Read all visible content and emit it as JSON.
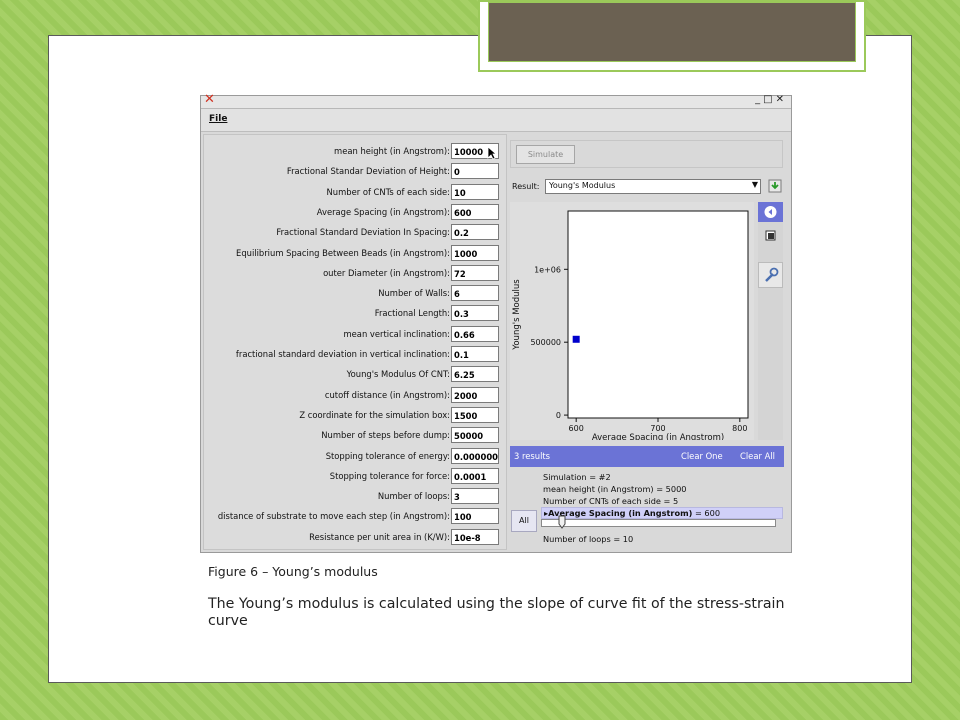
{
  "app": {
    "menu_file": "File",
    "params": [
      {
        "label": "mean height (in Angstrom):",
        "value": "10000"
      },
      {
        "label": "Fractional Standar Deviation of Height:",
        "value": "0"
      },
      {
        "label": "Number of CNTs of each side:",
        "value": "10"
      },
      {
        "label": "Average Spacing (in Angstrom):",
        "value": "600"
      },
      {
        "label": "Fractional Standard Deviation In Spacing:",
        "value": "0.2"
      },
      {
        "label": "Equilibrium Spacing Between Beads (in Angstrom):",
        "value": "1000"
      },
      {
        "label": "outer Diameter (in Angstrom):",
        "value": "72"
      },
      {
        "label": "Number of Walls:",
        "value": "6"
      },
      {
        "label": "Fractional Length:",
        "value": "0.3"
      },
      {
        "label": "mean vertical inclination:",
        "value": "0.66"
      },
      {
        "label": "fractional standard deviation in vertical inclination:",
        "value": "0.1"
      },
      {
        "label": "Young's Modulus Of CNT:",
        "value": "6.25"
      },
      {
        "label": "cutoff distance (in Angstrom):",
        "value": "2000"
      },
      {
        "label": "Z coordinate for the simulation box:",
        "value": "1500"
      },
      {
        "label": "Number of steps before dump:",
        "value": "50000"
      },
      {
        "label": "Stopping tolerance of energy:",
        "value": "0.0000000"
      },
      {
        "label": "Stopping tolerance for force:",
        "value": "0.0001"
      },
      {
        "label": "Number of loops:",
        "value": "3"
      },
      {
        "label": "distance of substrate to move each step (in Angstrom):",
        "value": "100"
      },
      {
        "label": "Resistance per unit area in (K/W):",
        "value": "10e-8"
      }
    ],
    "simulate_label": "Simulate",
    "result_label": "Result:",
    "result_value": "Young's Modulus",
    "results_count": "3 results",
    "clear_one": "Clear One",
    "clear_all": "Clear All",
    "all_label": "All",
    "info": {
      "simulation": "Simulation = #2",
      "mean_height": "mean height (in Angstrom) = 5000",
      "num_cnts": "Number of CNTs of each side = 5",
      "spacing_name": "Average Spacing (in Angstrom)",
      "spacing_value": " = 600",
      "loops": "Number of loops = 10"
    }
  },
  "chart_data": {
    "type": "scatter",
    "xlabel": "Average Spacing (in Angstrom)",
    "ylabel": "Young's Modulus",
    "xlim": [
      590,
      810
    ],
    "ylim": [
      -20000,
      1400000
    ],
    "x_ticks": [
      600,
      700,
      800
    ],
    "x_tick_labels": [
      "600",
      "700",
      "800"
    ],
    "y_ticks": [
      0,
      500000,
      1000000
    ],
    "y_tick_labels": [
      "0",
      "500000",
      "1e+06"
    ],
    "points": [
      {
        "x": 600,
        "y": 520000
      }
    ],
    "color": "#0000cc"
  },
  "caption": "Figure 6 – Young’s modulus",
  "body_text": "The Young’s modulus is calculated using the slope of curve fit of the stress-strain curve"
}
